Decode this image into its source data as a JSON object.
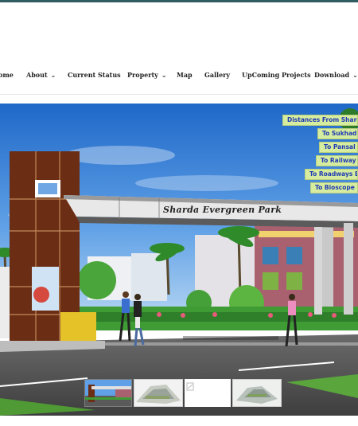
{
  "nav": {
    "items": [
      {
        "label": "ome",
        "dropdown": false
      },
      {
        "label": "About",
        "dropdown": true
      },
      {
        "label": "Current Status",
        "dropdown": false
      },
      {
        "label": "Property",
        "dropdown": true
      },
      {
        "label": "Map",
        "dropdown": false
      },
      {
        "label": "Gallery",
        "dropdown": false
      },
      {
        "label": "UpComing Projects",
        "dropdown": false
      },
      {
        "label": "Download",
        "dropdown": true
      }
    ]
  },
  "hero": {
    "gate_sign": "Sharda Evergreen Park"
  },
  "side_links": [
    "Distances From Shard",
    "To Sukhadi",
    "To Pansal",
    "To Railway",
    "To Roadways B",
    "To Bioscope"
  ],
  "colors": {
    "top_bar": "#2f5d62",
    "link_bg": "#d6ec9e",
    "link_text": "#1f3bb5"
  }
}
